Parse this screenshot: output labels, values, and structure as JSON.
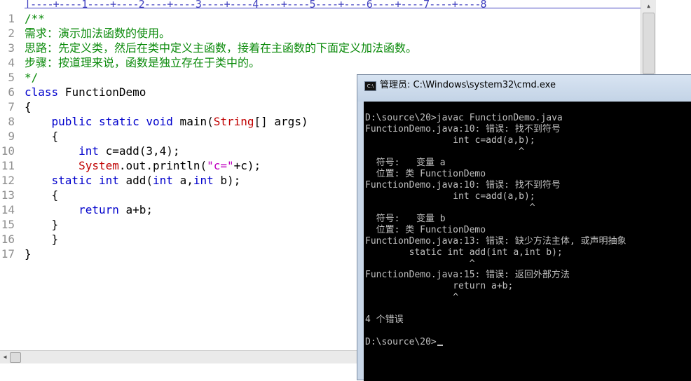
{
  "editor": {
    "ruler": "|----+----1----+----2----+----3----+----4----+----5----+----6----+----7----+----8",
    "line_numbers": [
      "1",
      "2",
      "3",
      "4",
      "5",
      "6",
      "7",
      "8",
      "9",
      "10",
      "11",
      "12",
      "13",
      "14",
      "15",
      "16",
      "17"
    ],
    "code": {
      "l1": "/**",
      "l2": "需求：演示加法函数的使用。",
      "l3": "思路：先定义类，然后在类中定义主函数，接着在主函数的下面定义加法函数。",
      "l4": "步骤：按道理来说，函数是独立存在于类中的。",
      "l5": "*/",
      "l6_kw": "class",
      "l6_rest": " FunctionDemo",
      "l7": "{",
      "l8_indent": "    ",
      "l8_kw": "public static void",
      "l8_mid": " main(",
      "l8_type": "String",
      "l8_rest": "[] args)",
      "l9": "    {",
      "l10_indent": "        ",
      "l10_kw": "int",
      "l10_rest": " c=add(3,4);",
      "l11_indent": "        ",
      "l11_type": "System",
      "l11_mid": ".out.println(",
      "l11_str": "\"c=\"",
      "l11_rest": "+c);",
      "l12_indent": "    ",
      "l12_kw1": "static int",
      "l12_mid": " add(",
      "l12_kw2": "int",
      "l12_mid2": " a,",
      "l12_kw3": "int",
      "l12_rest": " b);",
      "l13": "    {",
      "l14_indent": "        ",
      "l14_kw": "return",
      "l14_rest": " a+b;",
      "l15": "    }",
      "l16": "    }",
      "l17": "}"
    }
  },
  "cmd": {
    "icon_label": "C:\\",
    "title": "管理员: C:\\Windows\\system32\\cmd.exe",
    "lines": [
      "D:\\source\\20>javac FunctionDemo.java",
      "FunctionDemo.java:10: 错误: 找不到符号",
      "                int c=add(a,b);",
      "                            ^",
      "  符号:   变量 a",
      "  位置: 类 FunctionDemo",
      "FunctionDemo.java:10: 错误: 找不到符号",
      "                int c=add(a,b);",
      "                              ^",
      "  符号:   变量 b",
      "  位置: 类 FunctionDemo",
      "FunctionDemo.java:13: 错误: 缺少方法主体, 或声明抽象",
      "        static int add(int a,int b);",
      "                   ^",
      "FunctionDemo.java:15: 错误: 返回外部方法",
      "                return a+b;",
      "                ^",
      "",
      "4 个错误",
      "",
      "D:\\source\\20>"
    ]
  },
  "colors": {
    "comment": "#0a8a0a",
    "keyword": "#0000cc",
    "type": "#c00000",
    "string": "#c000c0",
    "line_number": "#909090"
  },
  "icons": {
    "scroll_up": "triangle-up",
    "scroll_left": "triangle-left"
  }
}
